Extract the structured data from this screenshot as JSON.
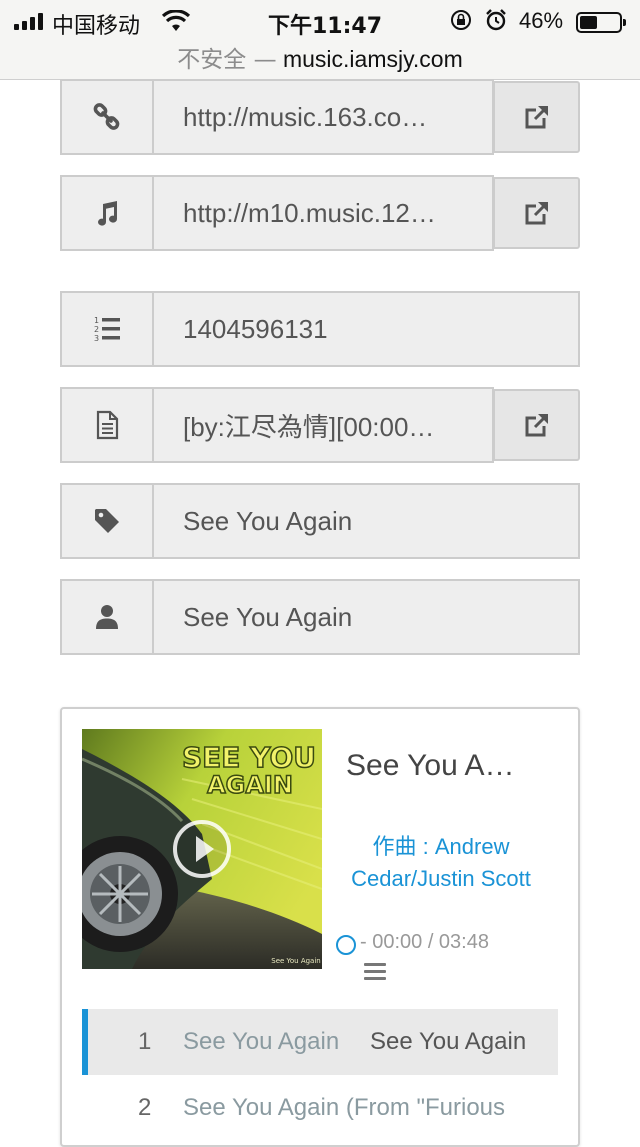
{
  "status_bar": {
    "carrier": "中国移动",
    "time": "下午11:47",
    "battery_percent": "46%",
    "battery_level": 0.46,
    "insecure_label": "不安全 —",
    "url": "music.iamsjy.com"
  },
  "fields": {
    "page_link": "http://music.163.co…",
    "audio_url": "http://m10.music.12…",
    "song_id": "1404596131",
    "lyrics": "[by:江尽為情][00:00…",
    "title": "See You Again",
    "artist": "See You Again"
  },
  "icons": {
    "link": "link-icon",
    "music": "music-note-icon",
    "id": "ordered-list-icon",
    "lyrics": "file-text-icon",
    "title": "tag-icon",
    "artist": "user-icon",
    "open": "external-link-icon"
  },
  "player": {
    "cover_text_line1": "SEE YOU",
    "cover_text_line2": "AGAIN",
    "cover_caption": "See You Again",
    "title": "See You A…",
    "composer": "作曲 : Andrew Cedar/Justin Scott",
    "time": "- 00:00 / 03:48",
    "accent_color": "#1a93d6",
    "playlist": [
      {
        "num": "1",
        "name": "See You Again",
        "artist": "See You Again",
        "active": true
      },
      {
        "num": "2",
        "name": "See You Again (From \"Furious",
        "artist": "",
        "active": false
      }
    ]
  }
}
